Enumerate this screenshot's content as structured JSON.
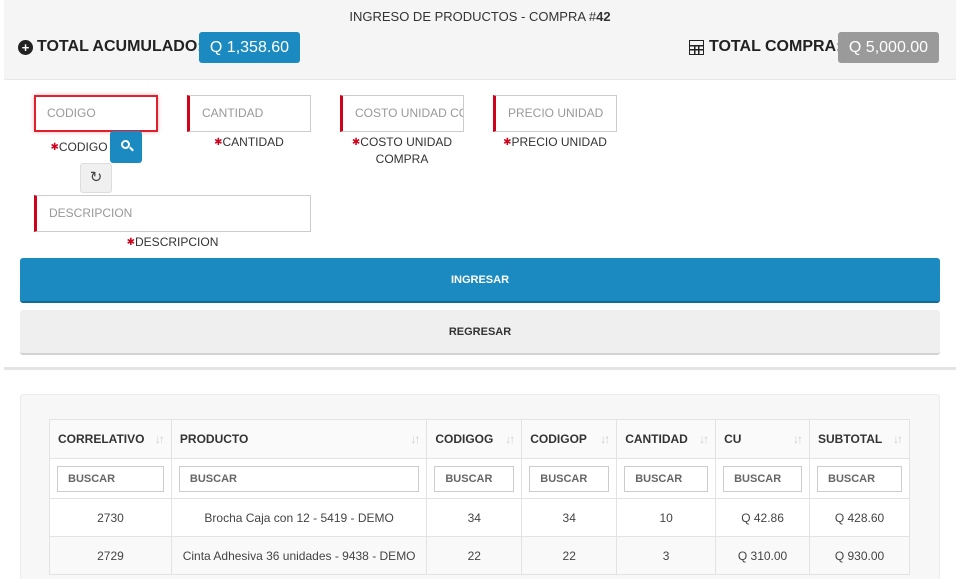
{
  "header": {
    "title_prefix": "INGRESO DE PRODUCTOS - COMPRA #",
    "compra_number": "42",
    "total_acumulado_label": "TOTAL ACUMULADO:",
    "total_acumulado_value": "Q 1,358.60",
    "total_compra_label": "TOTAL COMPRA:",
    "total_compra_value": "Q 5,000.00"
  },
  "form": {
    "codigo": {
      "placeholder": "CODIGO",
      "label": "CODIGO"
    },
    "cantidad": {
      "placeholder": "CANTIDAD",
      "label": "CANTIDAD"
    },
    "costo": {
      "placeholder": "COSTO UNIDAD COMPRA",
      "label_line1": "COSTO UNIDAD",
      "label_line2": "COMPRA"
    },
    "precio": {
      "placeholder": "PRECIO UNIDAD",
      "label": "PRECIO UNIDAD"
    },
    "descripcion": {
      "placeholder": "DESCRIPCION",
      "label": "DESCRIPCION"
    },
    "ingresar_label": "INGRESAR",
    "regresar_label": "REGRESAR"
  },
  "table": {
    "columns": [
      "CORRELATIVO",
      "PRODUCTO",
      "CODIGOG",
      "CODIGOP",
      "CANTIDAD",
      "CU",
      "SUBTOTAL"
    ],
    "filter_placeholder": "BUSCAR",
    "rows": [
      [
        "2730",
        "Brocha Caja con 12 - 5419 - DEMO",
        "34",
        "34",
        "10",
        "Q 42.86",
        "Q 428.60"
      ],
      [
        "2729",
        "Cinta Adhesiva 36 unidades - 9438 - DEMO",
        "22",
        "22",
        "3",
        "Q 310.00",
        "Q 930.00"
      ]
    ]
  },
  "icons": {
    "accumulated": "plus-circle-icon",
    "total": "calculator-icon",
    "search": "search-icon",
    "refresh": "refresh-icon",
    "sort": "sort-icon"
  },
  "colors": {
    "primary": "#1a8ac0",
    "required": "#d0021b",
    "badge_gray": "#9a9a9a"
  }
}
